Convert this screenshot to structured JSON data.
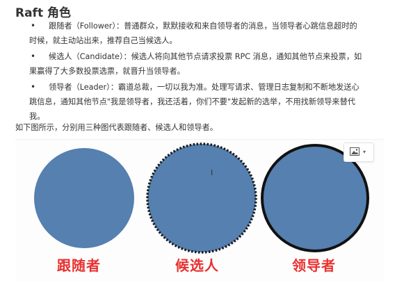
{
  "heading": "Raft 角色",
  "roles": [
    {
      "line1": "跟随者（Follower）：普通群众，默默接收和来自领导者的消息，当领导者心跳信息超时的",
      "line2": "时候，就主动站出来，推荐自己当候选人。"
    },
    {
      "line1": "候选人（Candidate）：候选人将向其他节点请求投票 RPC 消息，通知其他节点来投票，如",
      "line2": "果赢得了大多数投票选票，就晋升当领导者。"
    },
    {
      "line1": "领导者（Leader）：霸道总裁，一切以我为准。处理写请求、管理日志复制和不断地发送心",
      "line2": "跳信息，通知其他节点\"我是领导者，我还活着，你们不要\"发起新的选举，不用找新领导来替代",
      "line3": "我。"
    }
  ],
  "figure_intro": "如下图所示，分别用三种图代表跟随者、候选人和领导者。",
  "figure_labels": {
    "follower": "跟随者",
    "candidate": "候选人",
    "leader": "领导者"
  },
  "colors": {
    "circle_fill": "#5580b0",
    "label_red": "#e8302f"
  },
  "image_menu_icon": "image-icon"
}
